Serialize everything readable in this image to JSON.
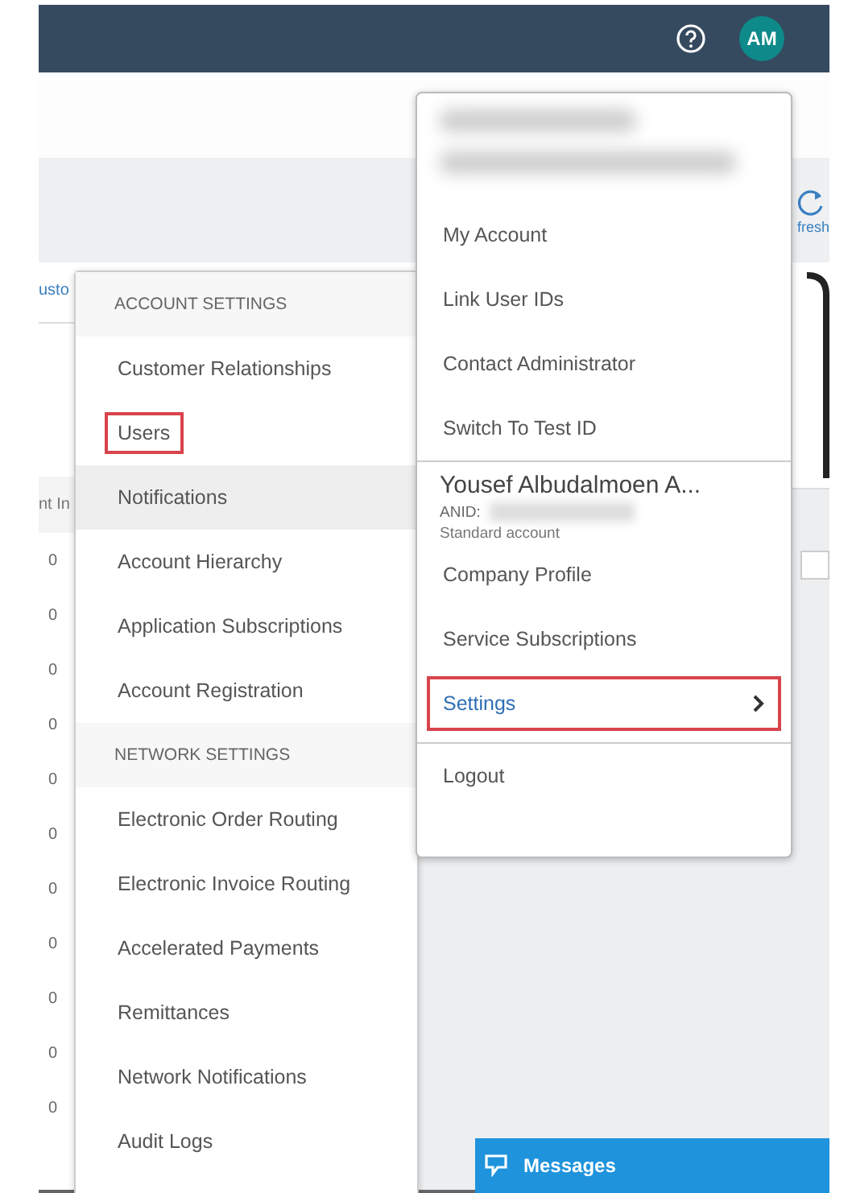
{
  "header": {
    "avatar": "AM"
  },
  "toolbar": {
    "refresh_label": "fresh"
  },
  "page": {
    "link": "usto",
    "column_header": "nt In",
    "cells": [
      "0",
      "0",
      "0",
      "0",
      "0",
      "0",
      "0",
      "0",
      "0",
      "0",
      "0"
    ]
  },
  "settings_menu": {
    "sections": [
      {
        "title": "ACCOUNT SETTINGS",
        "items": [
          {
            "label": "Customer Relationships",
            "hovered": false,
            "highlighted": false
          },
          {
            "label": "Users",
            "hovered": false,
            "highlighted": true
          },
          {
            "label": "Notifications",
            "hovered": true,
            "highlighted": false
          },
          {
            "label": "Account Hierarchy",
            "hovered": false,
            "highlighted": false
          },
          {
            "label": "Application Subscriptions",
            "hovered": false,
            "highlighted": false
          },
          {
            "label": "Account Registration",
            "hovered": false,
            "highlighted": false
          }
        ]
      },
      {
        "title": "NETWORK SETTINGS",
        "items": [
          {
            "label": "Electronic Order Routing",
            "hovered": false,
            "highlighted": false
          },
          {
            "label": "Electronic Invoice Routing",
            "hovered": false,
            "highlighted": false
          },
          {
            "label": "Accelerated Payments",
            "hovered": false,
            "highlighted": false
          },
          {
            "label": "Remittances",
            "hovered": false,
            "highlighted": false
          },
          {
            "label": "Network Notifications",
            "hovered": false,
            "highlighted": false
          },
          {
            "label": "Audit Logs",
            "hovered": false,
            "highlighted": false
          }
        ]
      }
    ]
  },
  "account_menu": {
    "top_items": [
      {
        "label": "My Account"
      },
      {
        "label": "Link User IDs"
      },
      {
        "label": "Contact Administrator"
      },
      {
        "label": "Switch To Test ID"
      }
    ],
    "profile": {
      "name": "Yousef Albudalmoen A...",
      "anid_label": "ANID:",
      "account_type": "Standard account"
    },
    "items": [
      {
        "label": "Company Profile",
        "active": false,
        "highlighted": false,
        "submenu": false
      },
      {
        "label": "Service Subscriptions",
        "active": false,
        "highlighted": false,
        "submenu": false
      },
      {
        "label": "Settings",
        "active": true,
        "highlighted": true,
        "submenu": true
      }
    ],
    "bottom_items": [
      {
        "label": "Logout"
      }
    ]
  },
  "messages": {
    "label": "Messages"
  }
}
